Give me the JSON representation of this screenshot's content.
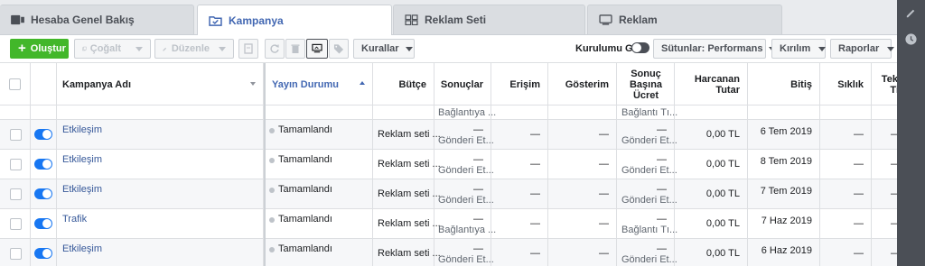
{
  "tabs": [
    {
      "label": "Hesaba Genel Bakış",
      "icon": "account-overview-icon"
    },
    {
      "label": "Kampanya",
      "icon": "campaign-folder-icon"
    },
    {
      "label": "Reklam Seti",
      "icon": "ad-set-grid-icon"
    },
    {
      "label": "Reklam",
      "icon": "ad-monitor-icon"
    }
  ],
  "toolbar": {
    "create": "Oluştur",
    "duplicate": "Çoğalt",
    "edit": "Düzenle",
    "rules": "Kurallar",
    "setup_toggle": "Kurulumu Gör",
    "columns": "Sütunlar: Performans",
    "breakdown": "Kırılım",
    "reports": "Raporlar"
  },
  "columns": {
    "name": "Kampanya Adı",
    "delivery": "Yayın Durumu",
    "budget": "Bütçe",
    "results": "Sonuçlar",
    "reach": "Erişim",
    "impressions": "Gösterim",
    "cost_per_result_1": "Sonuç",
    "cost_per_result_2": "Başına",
    "cost_per_result_3": "Ücret",
    "spent": "Harcanan Tutar",
    "ends": "Bitiş",
    "frequency": "Sıklık",
    "more_1": "Teki",
    "more_2": "Ti"
  },
  "partial_row": {
    "results_sub": "Bağlantıya ...",
    "cost_sub": "Bağlantı Tı..."
  },
  "rows": [
    {
      "name": "Etkileşim",
      "status": "Tamamlandı",
      "budget": "Reklam seti ...",
      "results": "—",
      "results_sub": "Gönderi Et...",
      "reach": "—",
      "impressions": "—",
      "cost": "—",
      "cost_sub": "Gönderi Et...",
      "spent": "0,00 TL",
      "ends": "6 Tem 2019",
      "freq": "—",
      "more": "—"
    },
    {
      "name": "Etkileşim",
      "status": "Tamamlandı",
      "budget": "Reklam seti ...",
      "results": "—",
      "results_sub": "Gönderi Et...",
      "reach": "—",
      "impressions": "—",
      "cost": "—",
      "cost_sub": "Gönderi Et...",
      "spent": "0,00 TL",
      "ends": "8 Tem 2019",
      "freq": "—",
      "more": "—"
    },
    {
      "name": "Etkileşim",
      "status": "Tamamlandı",
      "budget": "Reklam seti ...",
      "results": "—",
      "results_sub": "Gönderi Et...",
      "reach": "—",
      "impressions": "—",
      "cost": "—",
      "cost_sub": "Gönderi Et...",
      "spent": "0,00 TL",
      "ends": "7 Tem 2019",
      "freq": "—",
      "more": "—"
    },
    {
      "name": "Trafik",
      "status": "Tamamlandı",
      "budget": "Reklam seti ...",
      "results": "—",
      "results_sub": "Bağlantıya ...",
      "reach": "—",
      "impressions": "—",
      "cost": "—",
      "cost_sub": "Bağlantı Tı...",
      "spent": "0,00 TL",
      "ends": "7 Haz 2019",
      "freq": "—",
      "more": "—"
    },
    {
      "name": "Etkileşim",
      "status": "Tamamlandı",
      "budget": "Reklam seti ...",
      "results": "—",
      "results_sub": "Gönderi Et...",
      "reach": "—",
      "impressions": "—",
      "cost": "—",
      "cost_sub": "Gönderi Et...",
      "spent": "0,00 TL",
      "ends": "6 Haz 2019",
      "freq": "—",
      "more": "—"
    }
  ],
  "colors": {
    "accent": "#4267b2",
    "create_green": "#42b72a",
    "toggle_blue": "#1877f2",
    "link": "#365899"
  }
}
